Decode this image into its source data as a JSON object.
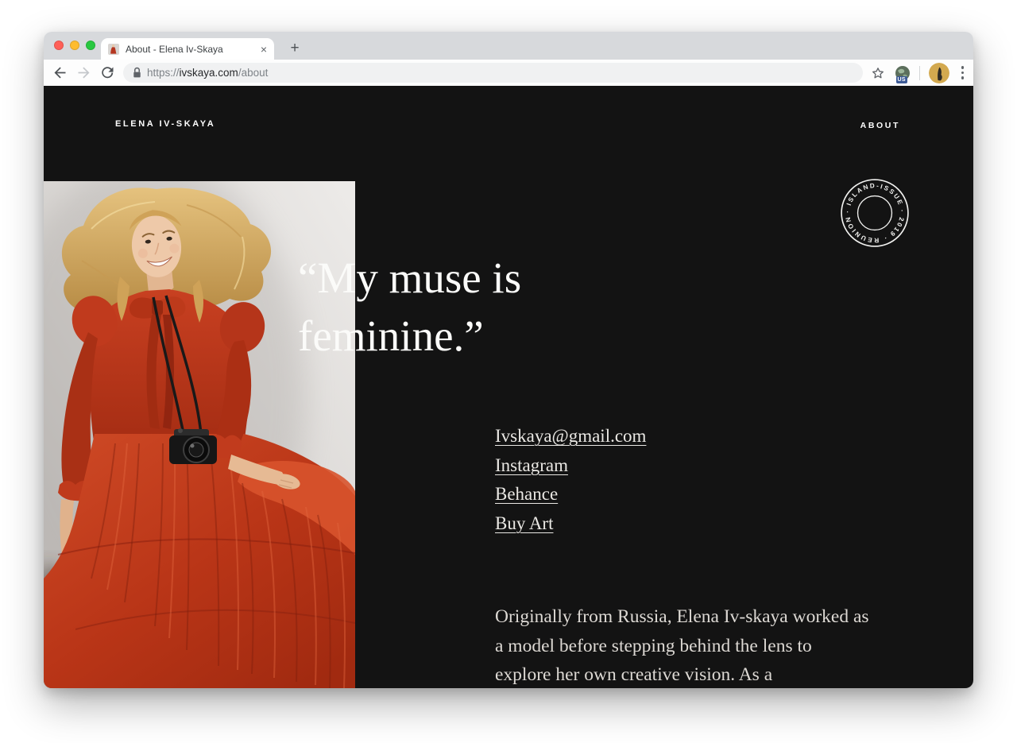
{
  "browser": {
    "tab_title": "About - Elena Iv-Skaya",
    "tab_close_glyph": "×",
    "new_tab_glyph": "+",
    "url": {
      "scheme": "https://",
      "host": "ivskaya.com",
      "path": "/about"
    },
    "extension_badge": "US"
  },
  "page": {
    "logo": "ELENA IV-SKAYA",
    "nav_about": "ABOUT",
    "stamp_text": "· ISLAND-ISSUE · 2019 · REUNION ",
    "quote": {
      "line1": "“My muse is",
      "line2": "feminine.”"
    },
    "links": [
      "Ivskaya@gmail.com",
      "Instagram",
      "Behance",
      "Buy Art"
    ],
    "bio_lines": [
      "Originally from Russia, Elena Iv-skaya worked as",
      "a model before stepping behind the lens to",
      "explore her own creative vision. As a"
    ],
    "colors": {
      "background": "#131313",
      "dress_red": "#c0391f",
      "text": "#ffffff"
    }
  }
}
